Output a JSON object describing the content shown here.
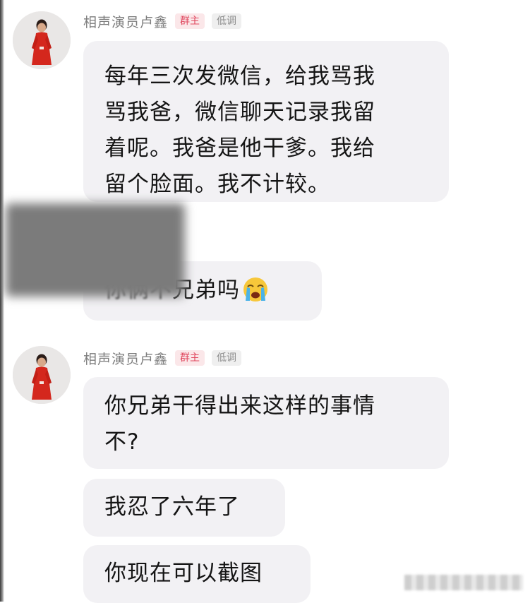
{
  "messages": [
    {
      "sender": "相声演员卢鑫",
      "role_badge": "群主",
      "level_badge": "低调",
      "bubbles": [
        {
          "lines": [
            "每年三次发微信，给我骂我",
            "骂我爸，微信聊天记录我留",
            "着呢。我爸是他干爹。我给",
            "留个脸面。我不计较。"
          ]
        }
      ]
    },
    {
      "sender_obscured": true,
      "bubbles": [
        {
          "partial_text": "你俩不",
          "text": "兄弟吗",
          "emoji": "loudly-crying-face-icon"
        }
      ]
    },
    {
      "sender": "相声演员卢鑫",
      "role_badge": "群主",
      "level_badge": "低调",
      "bubbles": [
        {
          "lines": [
            "你兄弟干得出来这样的事情",
            "不?"
          ]
        },
        {
          "lines": [
            "我忍了六年了"
          ]
        },
        {
          "lines": [
            "你现在可以截图"
          ]
        }
      ]
    }
  ],
  "colors": {
    "bubble_background": "#f2f1f4",
    "owner_badge_text": "#e0485f",
    "owner_badge_background": "#fbe7e9",
    "name_text": "#7d7d7d"
  }
}
